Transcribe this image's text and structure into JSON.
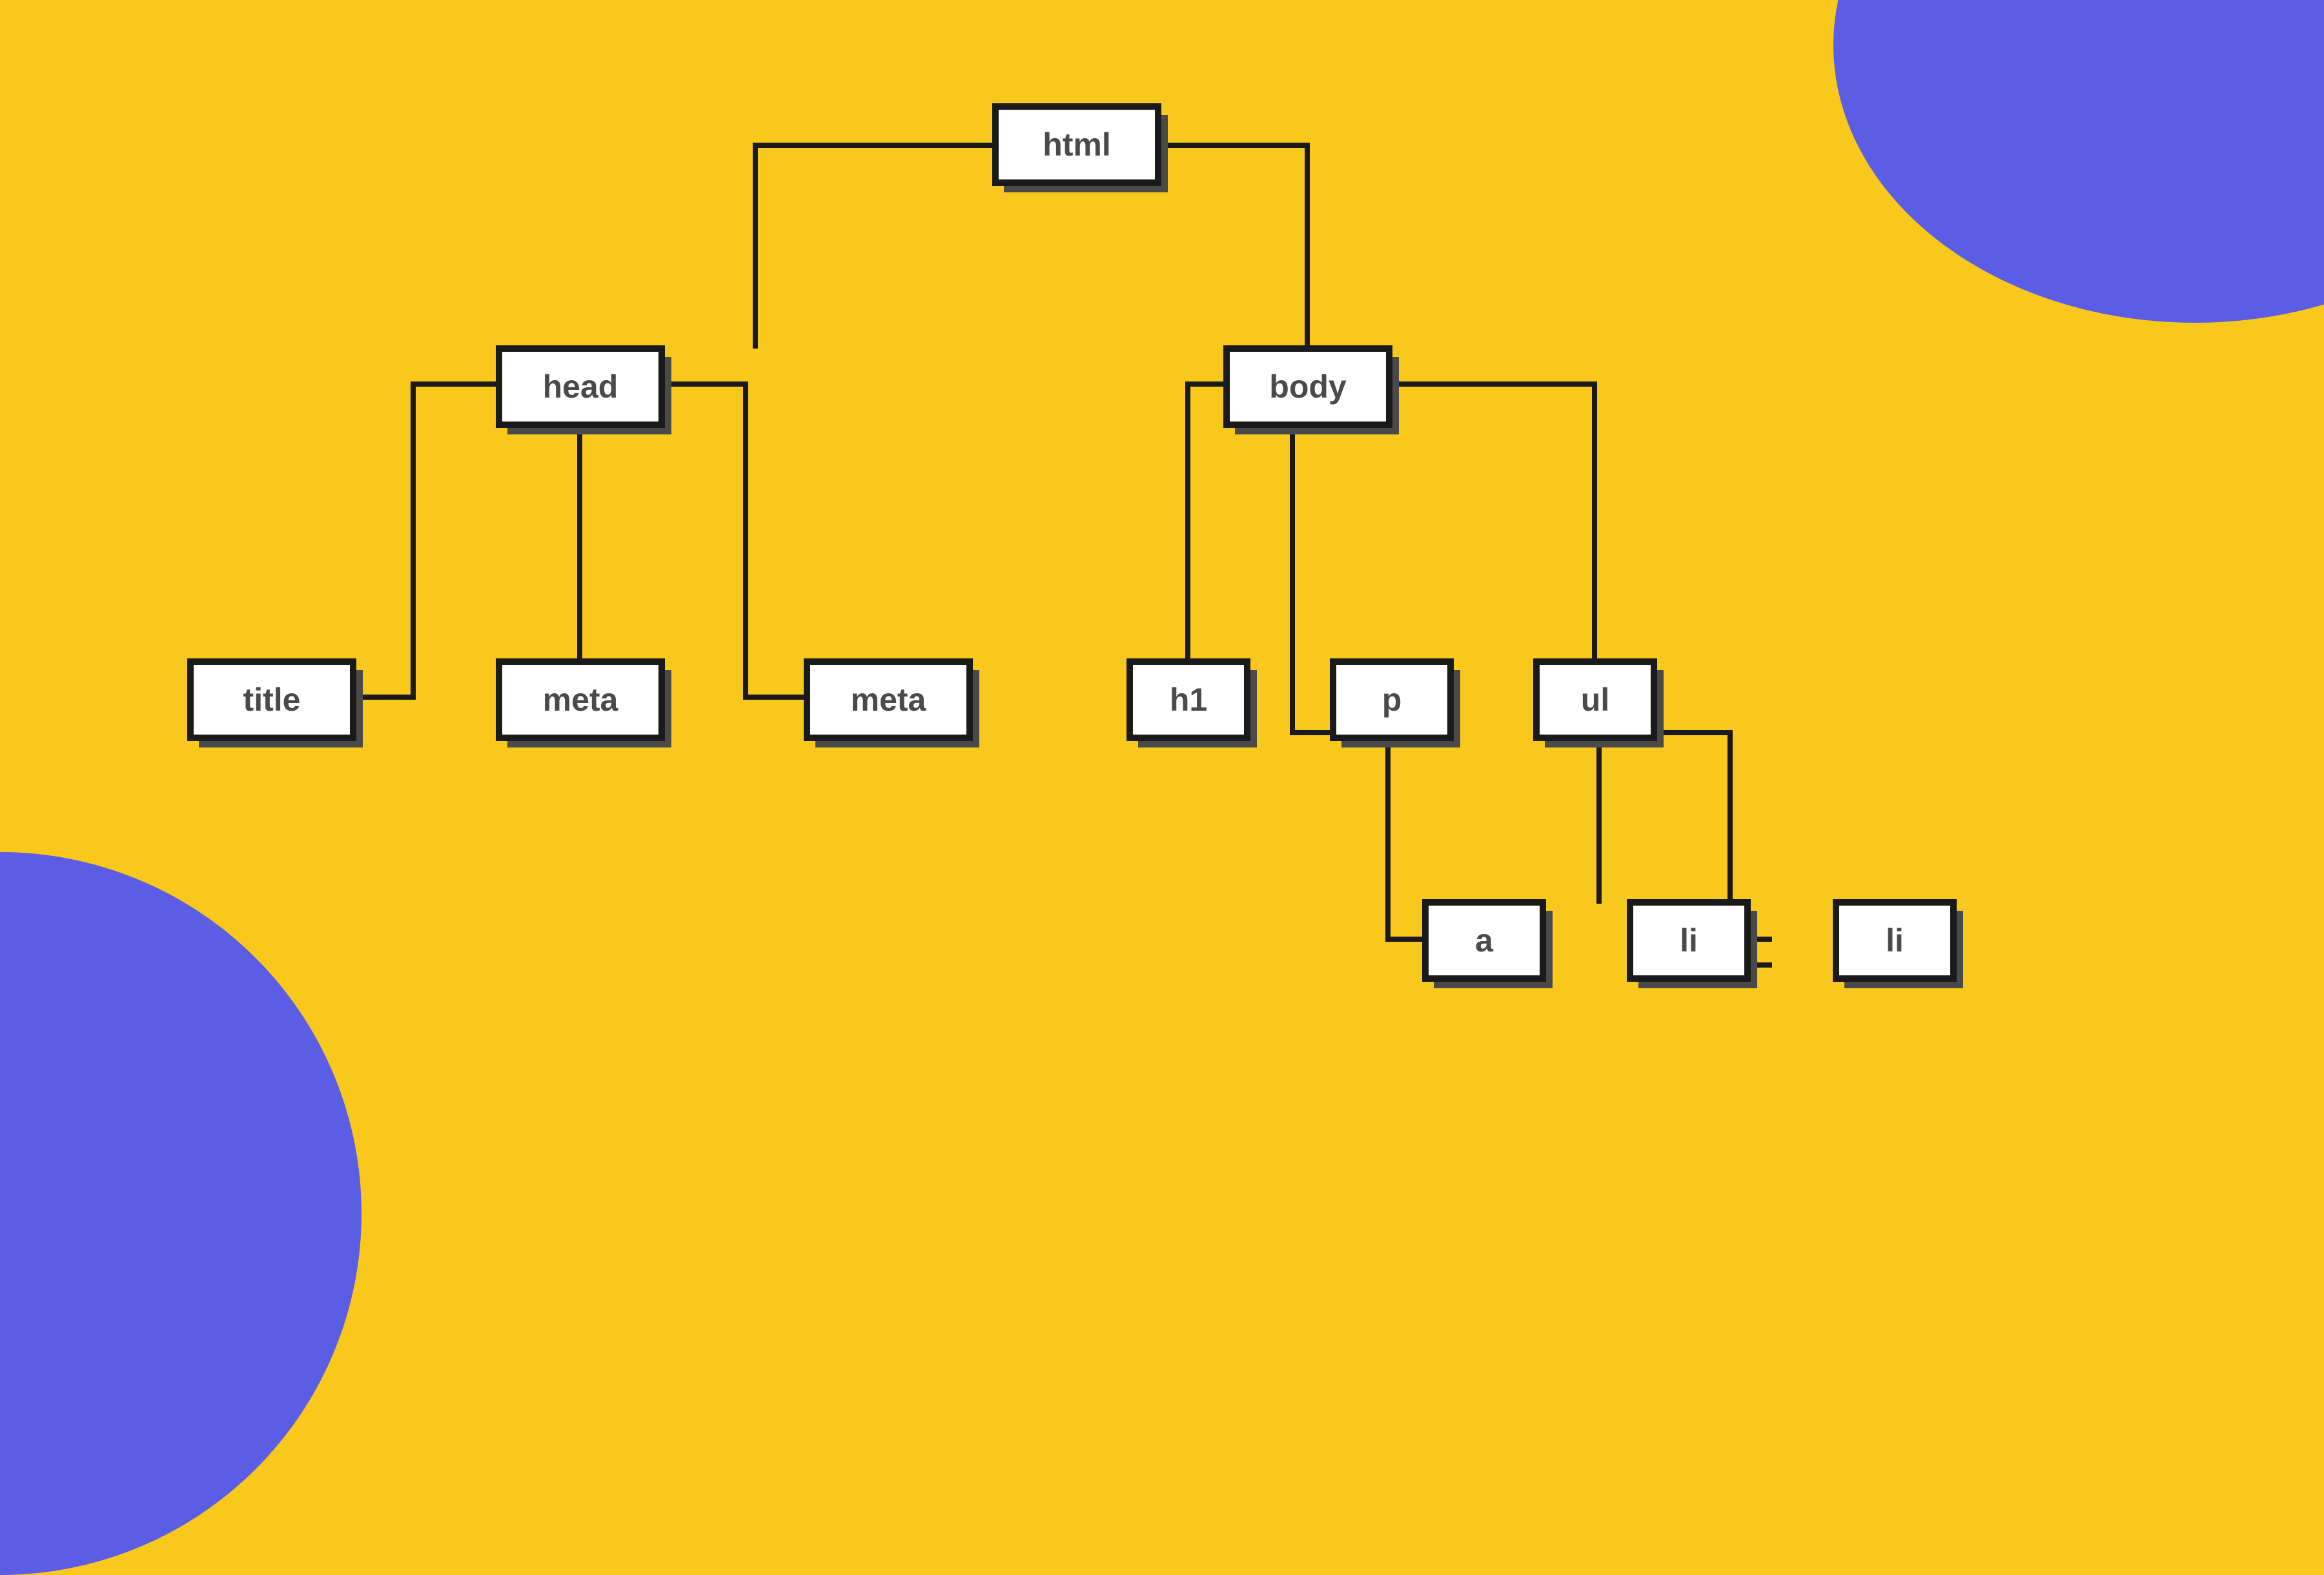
{
  "colors": {
    "background": "#f9c81c",
    "accent": "#5b5de5",
    "node_fill": "#ffffff",
    "node_border": "#1a1a1a",
    "node_shadow": "#4a4a4a",
    "text": "#4a4a4a"
  },
  "diagram": {
    "root": {
      "label": "html"
    },
    "left_branch": {
      "parent": {
        "label": "head"
      },
      "children": [
        {
          "label": "title"
        },
        {
          "label": "meta"
        },
        {
          "label": "meta"
        }
      ]
    },
    "right_branch": {
      "parent": {
        "label": "body"
      },
      "children": [
        {
          "label": "h1"
        },
        {
          "label": "p",
          "children": [
            {
              "label": "a"
            }
          ]
        },
        {
          "label": "ul",
          "children": [
            {
              "label": "li"
            },
            {
              "label": "li"
            }
          ]
        }
      ]
    }
  }
}
